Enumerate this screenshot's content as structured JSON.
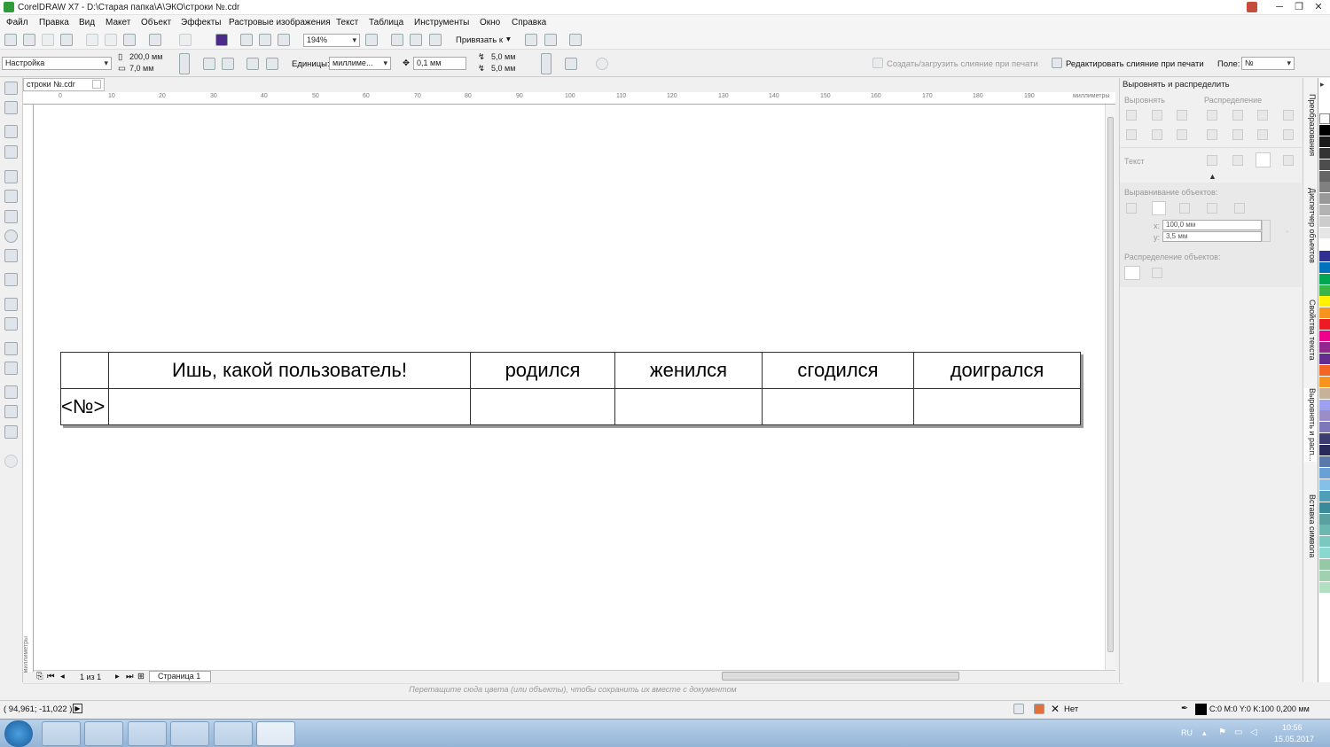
{
  "window": {
    "title": "CorelDRAW X7 - D:\\Старая папка\\А\\ЭКО\\строки №.cdr",
    "minimize": "─",
    "restore": "❐",
    "close": "✕"
  },
  "menu": [
    "Файл",
    "Правка",
    "Вид",
    "Макет",
    "Объект",
    "Эффекты",
    "Растровые изображения",
    "Текст",
    "Таблица",
    "Инструменты",
    "Окно",
    "Справка"
  ],
  "toolbar": {
    "zoom": "194%",
    "snap": "Привязать к"
  },
  "propbar": {
    "preset": "Настройка",
    "width": "200,0 мм",
    "height": "7,0 мм",
    "units_label": "Единицы:",
    "units": "миллиме...",
    "nudge": "0,1 мм",
    "dup_x": "5,0 мм",
    "dup_y": "5,0 мм",
    "merge_create": "Создать/загрузить слияние при печати",
    "merge_edit": "Редактировать слияние при печати",
    "field_label": "Поле:",
    "field_value": "№"
  },
  "document": {
    "tab": "строки №.cdr",
    "ruler_units": "миллиметры",
    "ruler_ticks": [
      "0",
      "10",
      "20",
      "30",
      "40",
      "50",
      "60",
      "70",
      "80",
      "90",
      "100",
      "110",
      "120",
      "130",
      "140",
      "150",
      "160",
      "170",
      "180",
      "190"
    ],
    "vruler_label": "миллиметры"
  },
  "table": {
    "rows": [
      [
        "",
        "Ишь, какой пользователь!",
        "родился",
        "женился",
        "сгодился",
        "доигрался"
      ],
      [
        "<№>",
        "",
        "",
        "",
        "",
        ""
      ]
    ]
  },
  "pagenav": {
    "counter": "1 из 1",
    "page_tab": "Страница 1"
  },
  "hint": "Перетащите сюда цвета (или объекты), чтобы сохранить их вместе с документом",
  "status": {
    "coords": "( 94,961; -11,022 )",
    "fill": "Нет",
    "outline": "C:0 M:0 Y:0 K:100  0,200 мм"
  },
  "docker": {
    "title": "Выровнять и распределить",
    "align": "Выровнять",
    "distribute": "Распределение",
    "text": "Текст",
    "align_objects": "Выравнивание объектов:",
    "x_label": "x:",
    "x_value": "100,0 мм",
    "y_label": "y:",
    "y_value": "3,5 мм",
    "dist_objects": "Распределение объектов:"
  },
  "vtabs": [
    "Преобразования",
    "Диспетчер объектов",
    "Свойства текста",
    "Выровнять и расп...",
    "Вставка символа"
  ],
  "palette": [
    "#ffffff",
    "#000000",
    "#1a1a1a",
    "#333333",
    "#4d4d4d",
    "#666666",
    "#808080",
    "#999999",
    "#b3b3b3",
    "#cccccc",
    "#e6e6e6",
    "#ffffff",
    "#2e3192",
    "#0072bc",
    "#00a651",
    "#39b54a",
    "#fff200",
    "#f7941d",
    "#ed1c24",
    "#ec008c",
    "#92278f",
    "#662d91",
    "#f26522",
    "#f7941d",
    "#c7b299",
    "#a0a0f0",
    "#9b8dc8",
    "#7e77b8",
    "#3c3c6e",
    "#2a2a5a",
    "#5a78aa",
    "#6aa0d6",
    "#84c0e8",
    "#4ea0b8",
    "#3a8a9a",
    "#5aa0a0",
    "#6ab8b0",
    "#7ac8c0",
    "#8ad8d0",
    "#96c8a8",
    "#a0d0b0",
    "#b0e0c0"
  ],
  "taskbar": {
    "lang": "RU",
    "time": "10:56",
    "date": "15.05.2017"
  }
}
